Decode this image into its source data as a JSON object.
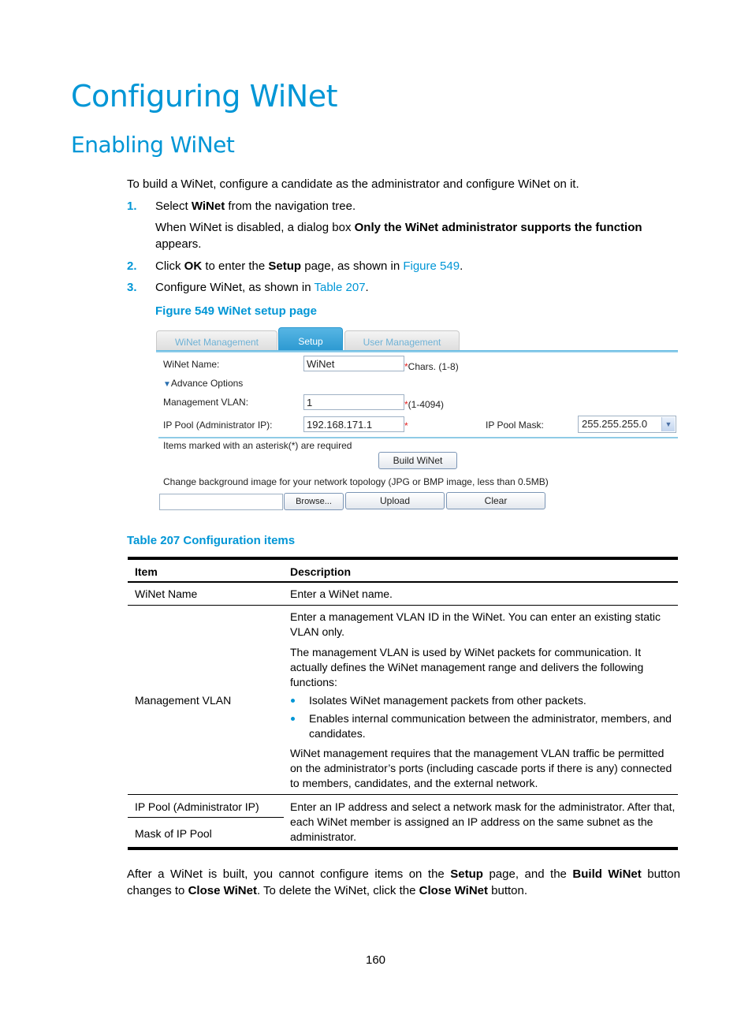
{
  "page": {
    "title": "Configuring WiNet",
    "section": "Enabling WiNet",
    "intro": "To build a WiNet, configure a candidate as the administrator and configure WiNet on it.",
    "steps": [
      {
        "number": "1.",
        "pre": "Select ",
        "bold": "WiNet",
        "post": " from the navigation tree.",
        "note_pre": "When WiNet is disabled, a dialog box ",
        "note_bold": "Only the WiNet administrator supports the function",
        "note_post": "appears."
      },
      {
        "number": "2.",
        "pre": "Click ",
        "bold1": "OK",
        "mid": " to enter the ",
        "bold2": "Setup",
        "post": " page, as shown in ",
        "link": "Figure 549",
        "end": "."
      },
      {
        "number": "3.",
        "pre": "Configure WiNet, as shown in ",
        "link": "Table 207",
        "end": "."
      }
    ],
    "figure_caption": "Figure 549 WiNet setup page",
    "table_caption": "Table 207 Configuration items",
    "outro": {
      "t1": "After a WiNet is built, you cannot configure items on the ",
      "b1": "Setup",
      "t2": " page, and the ",
      "b2": "Build WiNet",
      "t3": " button",
      "t4": "changes to ",
      "b3": "Close WiNet",
      "t5": ". To delete the WiNet, click the ",
      "b4": "Close WiNet",
      "t6": " button."
    },
    "page_number": "160"
  },
  "figure": {
    "tabs": [
      {
        "label": "WiNet Management",
        "active": false
      },
      {
        "label": "Setup",
        "active": true
      },
      {
        "label": "User Management",
        "active": false
      }
    ],
    "winet_name_label": "WiNet Name:",
    "winet_name_value": "WiNet",
    "winet_name_hint": "Chars. (1-8)",
    "advance_options": "Advance Options",
    "mgmt_vlan_label": "Management VLAN:",
    "mgmt_vlan_value": "1",
    "mgmt_vlan_hint": "(1-4094)",
    "ip_pool_label": "IP Pool (Administrator IP):",
    "ip_pool_value": "192.168.171.1",
    "ip_mask_label": "IP Pool Mask:",
    "ip_mask_value": "255.255.255.0",
    "asterisk": "*",
    "required_note": "Items marked with an asterisk(*) are required",
    "build_button": "Build WiNet",
    "bg_image_note": "Change background image for your network topology (JPG or BMP image, less than 0.5MB)",
    "file_value": "",
    "browse_button": "Browse...",
    "upload_button": "Upload",
    "clear_button": "Clear"
  },
  "table": {
    "headers": [
      "Item",
      "Description"
    ],
    "rows": [
      {
        "item": "WiNet Name",
        "description": [
          "Enter a WiNet name."
        ]
      },
      {
        "item": "Management VLAN",
        "description": [
          "Enter a management VLAN ID in the WiNet. You can enter an existing static VLAN only.",
          "The management VLAN is used by WiNet packets for communication. It actually defines the WiNet management range and delivers the following functions:",
          "WiNet management requires that the management VLAN traffic be permitted on the administrator’s ports (including cascade ports if there is any) connected to members, candidates, and the external network."
        ],
        "bullets": [
          "Isolates WiNet management packets from other packets.",
          "Enables internal communication between the administrator, members, and candidates."
        ]
      },
      {
        "item": "IP Pool (Administrator IP)",
        "description": [
          "Enter an IP address and select a network mask for the administrator. After that, each WiNet member is assigned an IP address on the same subnet as the administrator."
        ]
      },
      {
        "item": "Mask of IP Pool",
        "description": []
      }
    ]
  }
}
